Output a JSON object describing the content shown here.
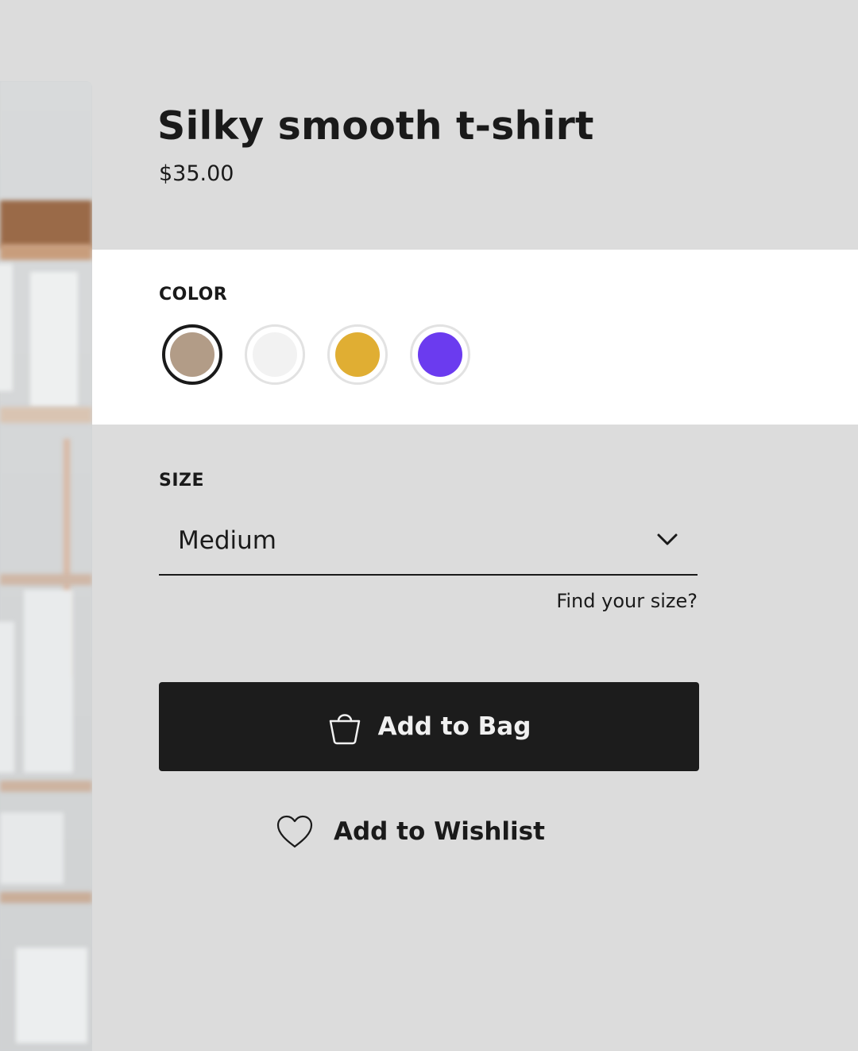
{
  "product": {
    "title": "Silky smooth t-shirt",
    "price": "$35.00"
  },
  "color": {
    "label": "COLOR",
    "swatches": [
      {
        "name": "taupe",
        "hex": "#b29c87",
        "selected": true
      },
      {
        "name": "white",
        "hex": "#f2f2f2",
        "selected": false
      },
      {
        "name": "mustard",
        "hex": "#e0ae33",
        "selected": false
      },
      {
        "name": "violet",
        "hex": "#6b3bef",
        "selected": false
      }
    ]
  },
  "size": {
    "label": "SIZE",
    "selected": "Medium",
    "find_size_link": "Find your size?"
  },
  "actions": {
    "add_to_bag": "Add to Bag",
    "add_to_wishlist": "Add to Wishlist"
  },
  "icons": {
    "bag": "shopping-bag-icon",
    "heart": "heart-icon",
    "chevron": "chevron-down-icon"
  },
  "theme": {
    "background": "#dcdcdc",
    "panel": "#ffffff",
    "button": "#1c1c1c"
  }
}
